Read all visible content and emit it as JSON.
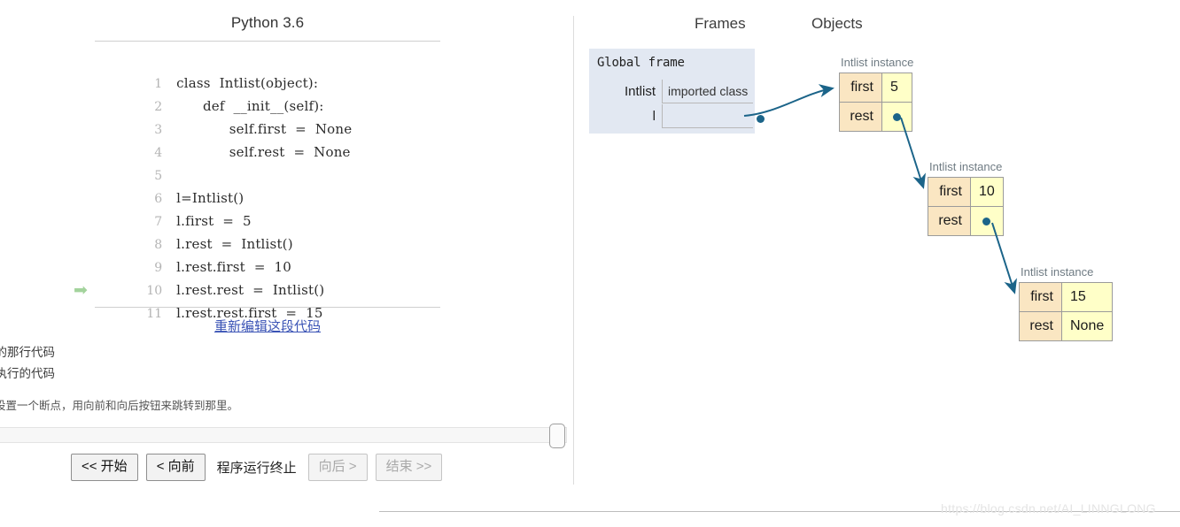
{
  "code_panel": {
    "language_title": "Python 3.6",
    "lines": [
      {
        "num": "1",
        "text": "class  Intlist(object):",
        "current": false
      },
      {
        "num": "2",
        "text": "      def  __init__(self):",
        "current": false
      },
      {
        "num": "3",
        "text": "            self.first  =  None",
        "current": false
      },
      {
        "num": "4",
        "text": "            self.rest  =  None",
        "current": false
      },
      {
        "num": "5",
        "text": "",
        "current": false
      },
      {
        "num": "6",
        "text": "l=Intlist()",
        "current": false
      },
      {
        "num": "7",
        "text": "l.first  =  5",
        "current": false
      },
      {
        "num": "8",
        "text": "l.rest  =  Intlist()",
        "current": false
      },
      {
        "num": "9",
        "text": "l.rest.first  =  10",
        "current": false
      },
      {
        "num": "10",
        "text": "l.rest.rest  =  Intlist()",
        "current": false
      },
      {
        "num": "11",
        "text": "l.rest.rest.first  =  15",
        "current": true
      }
    ],
    "current_line_arrow": "➡",
    "edit_link": "重新编辑这段代码",
    "legend": {
      "just_executed": "刚执行的那行代码",
      "next_to_execute": "一行要执行的代码",
      "hint": "行代码来设置一个断点，用向前和向后按钮来跳转到那里。"
    },
    "controls": {
      "first": "<< 开始",
      "back": "< 向前",
      "status": "程序运行终止",
      "forward": "向后 >",
      "last": "结束 >>",
      "first_enabled": true,
      "back_enabled": true,
      "forward_enabled": false,
      "last_enabled": false
    }
  },
  "viz_panel": {
    "frames_header": "Frames",
    "objects_header": "Objects",
    "global_frame": {
      "title": "Global frame",
      "rows": [
        {
          "name": "Intlist",
          "value": "imported class"
        },
        {
          "name": "l",
          "value": ""
        }
      ]
    },
    "objects": [
      {
        "label": "Intlist instance",
        "rows": [
          {
            "key": "first",
            "value": "5",
            "pointer": false
          },
          {
            "key": "rest",
            "value": "",
            "pointer": true
          }
        ]
      },
      {
        "label": "Intlist instance",
        "rows": [
          {
            "key": "first",
            "value": "10",
            "pointer": false
          },
          {
            "key": "rest",
            "value": "",
            "pointer": true
          }
        ]
      },
      {
        "label": "Intlist instance",
        "rows": [
          {
            "key": "first",
            "value": "15",
            "pointer": false
          },
          {
            "key": "rest",
            "value": "None",
            "pointer": false
          }
        ]
      }
    ]
  },
  "watermark": "https://blog.csdn.net/AI_LINNGLONG",
  "colors": {
    "pointer": "#1b6489",
    "frame_bg": "#e2e8f2",
    "obj_key_bg": "#fae6c2",
    "obj_val_bg": "#ffffc8",
    "link": "#3a53b5",
    "current_arrow": "#a3d39c"
  }
}
